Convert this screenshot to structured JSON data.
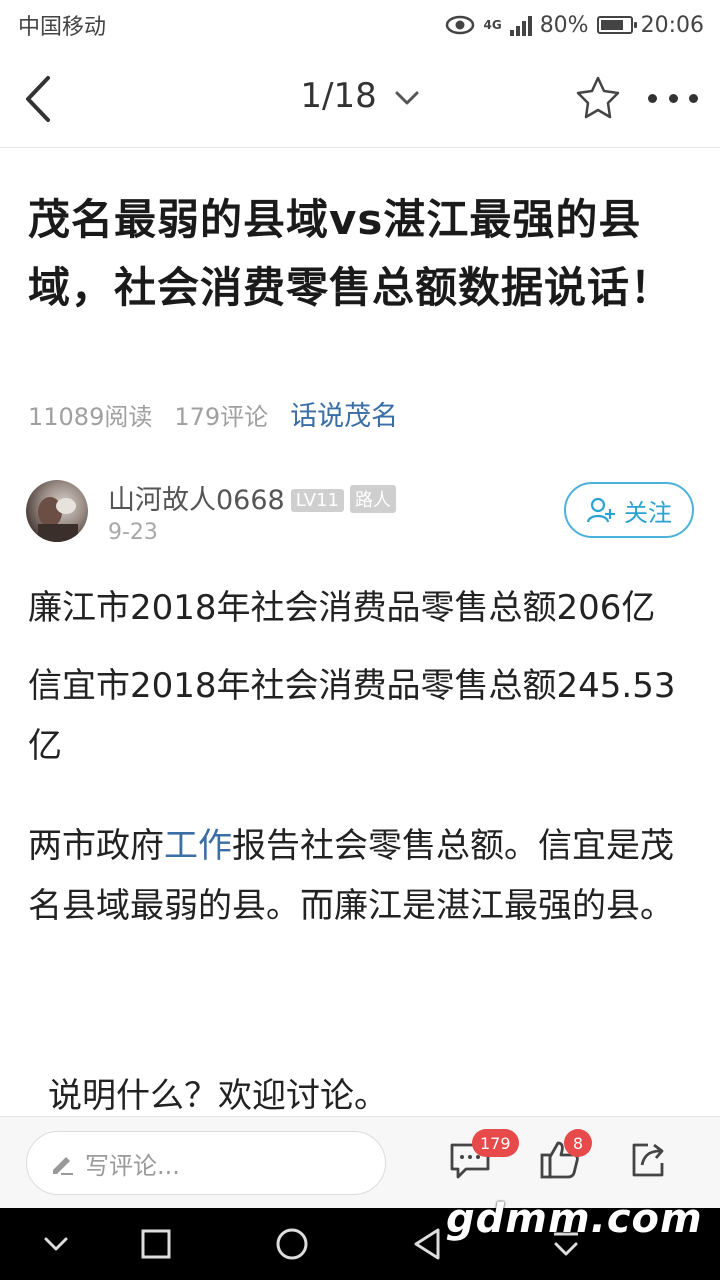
{
  "status_bar": {
    "carrier": "中国移动",
    "network": "4G",
    "battery": "80%",
    "time": "20:06"
  },
  "nav": {
    "pager": "1/18"
  },
  "article": {
    "title": "茂名最弱的县域vs湛江最强的县域，社会消费零售总额数据说话！",
    "reads": "11089阅读",
    "comments": "179评论",
    "topic": "话说茂名"
  },
  "author": {
    "name": "山河故人0668",
    "level": "LV11",
    "rank": "路人",
    "date": "9-23",
    "follow_label": "关注"
  },
  "content": {
    "p1": "廉江市2018年社会消费品零售总额206亿",
    "p2": "信宜市2018年社会消费品零售总额245.53亿",
    "p3_before": "两市政府",
    "p3_link": "工作",
    "p3_after": "报告社会零售总额。信宜是茂名县域最弱的县。而廉江是湛江最强的县。",
    "p4": "说明什么？欢迎讨论。"
  },
  "bottom_bar": {
    "comment_placeholder": "写评论...",
    "comment_count": "179",
    "like_count": "8"
  },
  "watermark": "gdmm.com",
  "colors": {
    "accent": "#2aa3d2",
    "link": "#3a6ea5",
    "badge": "#e64a4a"
  }
}
